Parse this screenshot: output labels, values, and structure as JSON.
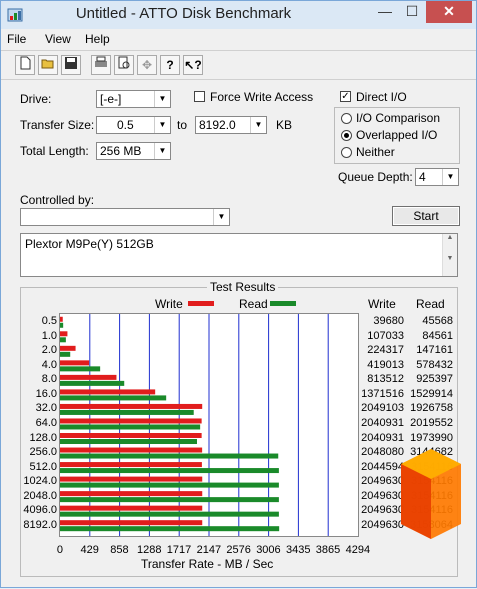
{
  "window": {
    "title": "Untitled - ATTO Disk Benchmark",
    "min_glyph": "—",
    "max_glyph": "☐",
    "close_glyph": "✕"
  },
  "menu": [
    "File",
    "View",
    "Help"
  ],
  "toolbar_icons": [
    "new-icon",
    "open-icon",
    "save-icon",
    "print-icon",
    "print-preview-icon",
    "move-icon",
    "help-icon",
    "context-help-icon"
  ],
  "form": {
    "drive_label": "Drive:",
    "drive_value": "[-e-]",
    "force_write_label": "Force Write Access",
    "force_write_checked": false,
    "direct_io_label": "Direct I/O",
    "direct_io_checked": true,
    "transfer_size_label": "Transfer Size:",
    "transfer_from": "0.5",
    "transfer_to_label": "to",
    "transfer_to": "8192.0",
    "transfer_unit": "KB",
    "total_length_label": "Total Length:",
    "total_length_value": "256 MB",
    "io_options": [
      "I/O Comparison",
      "Overlapped I/O",
      "Neither"
    ],
    "io_selected": "Overlapped I/O",
    "queue_depth_label": "Queue Depth:",
    "queue_depth_value": "4",
    "controlled_by_label": "Controlled by:",
    "controlled_by_value": "",
    "start_label": "Start",
    "description": "Plextor M9Pe(Y) 512GB"
  },
  "results": {
    "title": "Test Results",
    "write_legend": "Write",
    "read_legend": "Read",
    "write_col": "Write",
    "read_col": "Read",
    "write_color": "#e11d1d",
    "read_color": "#1a8a2a"
  },
  "chart_data": {
    "type": "bar",
    "orientation": "horizontal",
    "categories": [
      "0.5",
      "1.0",
      "2.0",
      "4.0",
      "8.0",
      "16.0",
      "32.0",
      "64.0",
      "128.0",
      "256.0",
      "512.0",
      "1024.0",
      "2048.0",
      "4096.0",
      "8192.0"
    ],
    "series": [
      {
        "name": "Write",
        "values": [
          39680,
          107033,
          224317,
          419013,
          813512,
          1371516,
          2049103,
          2040931,
          2040931,
          2048080,
          2044594,
          2049630,
          2049630,
          2049630,
          2049630
        ]
      },
      {
        "name": "Read",
        "values": [
          45568,
          84561,
          147161,
          578432,
          925397,
          1529914,
          1926758,
          2019552,
          1973990,
          3144682,
          3154116,
          3154116,
          3154116,
          3154116,
          3158064
        ]
      }
    ],
    "xlabel": "Transfer Rate - MB / Sec",
    "xticks": [
      "0",
      "429",
      "858",
      "1288",
      "1717",
      "2147",
      "2576",
      "3006",
      "3435",
      "3865",
      "4294"
    ],
    "xlim": [
      0,
      4294
    ],
    "grid": true
  }
}
